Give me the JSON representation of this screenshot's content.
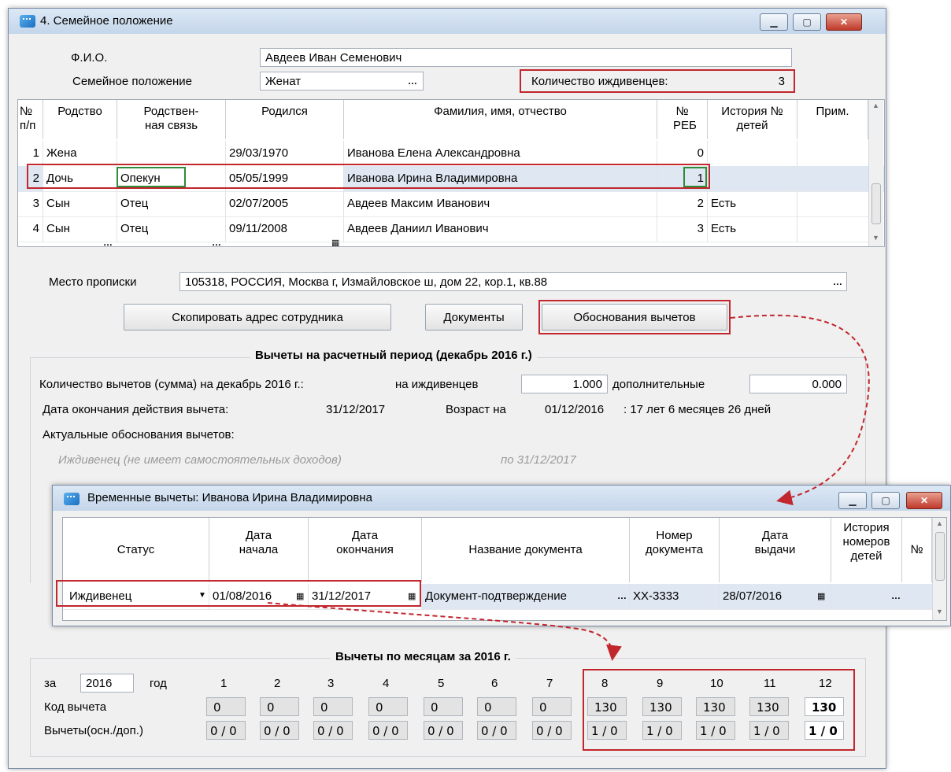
{
  "main_window": {
    "title": "4. Семейное положение",
    "fio_label": "Ф.И.О.",
    "fio_value": "Авдеев Иван Семенович",
    "marital_label": "Семейное положение",
    "marital_value": "Женат",
    "dependents_label": "Количество иждивенцев:",
    "dependents_value": "3",
    "ellipsis": "…"
  },
  "relatives_table": {
    "headers": {
      "num": "№ п/п",
      "relation": "Родство",
      "kinship": "Родствен-ная связь",
      "born": "Родился",
      "fio": "Фамилия, имя, отчество",
      "reb": "№ РЕБ",
      "history": "История № детей",
      "note": "Прим."
    },
    "rows": [
      {
        "num": "1",
        "relation": "Жена",
        "kinship": "",
        "born": "29/03/1970",
        "fio": "Иванова Елена Александровна",
        "reb": "0",
        "history": ""
      },
      {
        "num": "2",
        "relation": "Дочь",
        "kinship": "Опекун",
        "born": "05/05/1999",
        "fio": "Иванова Ирина Владимировна",
        "reb": "1",
        "history": ""
      },
      {
        "num": "3",
        "relation": "Сын",
        "kinship": "Отец",
        "born": "02/07/2005",
        "fio": "Авдеев Максим Иванович",
        "reb": "2",
        "history": "Есть"
      },
      {
        "num": "4",
        "relation": "Сын",
        "kinship": "Отец",
        "born": "09/11/2008",
        "fio": "Авдеев Даниил Иванович",
        "reb": "3",
        "history": "Есть"
      }
    ]
  },
  "address": {
    "label": "Место прописки",
    "value": "105318, РОССИЯ, Москва г, Измайловское ш, дом 22, кор.1, кв.88"
  },
  "buttons": {
    "copy_address": "Скопировать адрес сотрудника",
    "documents": "Документы",
    "justifications": "Обоснования вычетов"
  },
  "deductions_period": {
    "title": "Вычеты на расчетный период (декабрь 2016 г.)",
    "count_label": "Количество вычетов (сумма) на декабрь 2016 г.:",
    "dependents_label": "на иждивенцев",
    "dependents_value": "1.000",
    "additional_label": "дополнительные",
    "additional_value": "0.000",
    "end_date_label": "Дата окончания действия вычета:",
    "end_date_value": "31/12/2017",
    "age_label": "Возраст на",
    "age_date": "01/12/2016",
    "age_value": ": 17 лет 6 месяцев 26 дней",
    "actual_label": "Актуальные обоснования вычетов:",
    "actual_item": "Иждивенец (не имеет самостоятельных доходов)",
    "actual_until": "по 31/12/2017"
  },
  "temp_window": {
    "title": "Временные вычеты: Иванова Ирина Владимировна",
    "headers": {
      "status": "Статус",
      "start": "Дата начала",
      "end": "Дата окончания",
      "doc_name": "Название документа",
      "doc_num": "Номер документа",
      "issue": "Дата выдачи",
      "history": "История номеров детей",
      "num": "№"
    },
    "row": {
      "status": "Иждивенец",
      "start": "01/08/2016",
      "end": "31/12/2017",
      "doc_name": "Документ-подтверждение",
      "doc_num": "XX-3333",
      "issue": "28/07/2016"
    }
  },
  "monthly": {
    "title": "Вычеты по месяцам за 2016 г.",
    "for_label": "за",
    "year": "2016",
    "year_label": "год",
    "months": [
      "1",
      "2",
      "3",
      "4",
      "5",
      "6",
      "7",
      "8",
      "9",
      "10",
      "11",
      "12"
    ],
    "code_label": "Код вычета",
    "codes": [
      "0",
      "0",
      "0",
      "0",
      "0",
      "0",
      "0",
      "130",
      "130",
      "130",
      "130",
      "130"
    ],
    "deductions_label": "Вычеты(осн./доп.)",
    "deductions": [
      "0 / 0",
      "0 / 0",
      "0 / 0",
      "0 / 0",
      "0 / 0",
      "0 / 0",
      "0 / 0",
      "1 / 0",
      "1 / 0",
      "1 / 0",
      "1 / 0",
      "1 / 0"
    ]
  },
  "colors": {
    "highlight_red": "#c1272d",
    "highlight_green": "#2e8b3a",
    "arrow_red": "#c1272d"
  }
}
